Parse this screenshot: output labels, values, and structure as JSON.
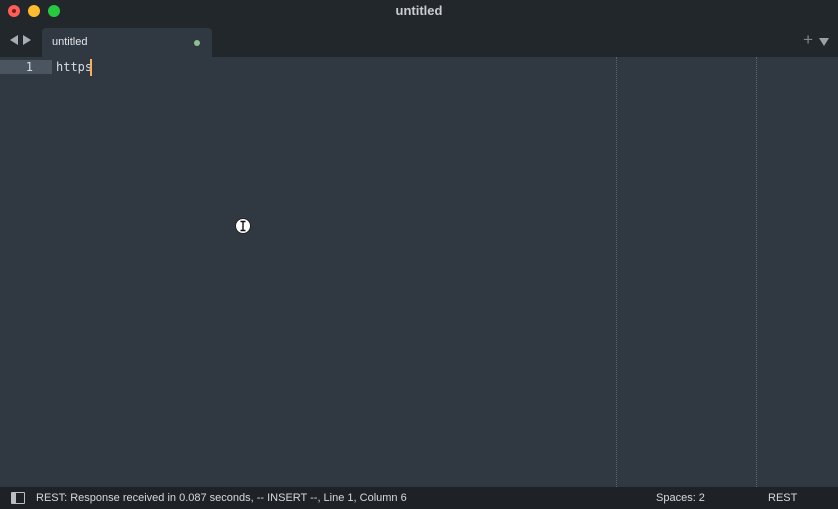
{
  "window": {
    "title": "untitled"
  },
  "tabs": [
    {
      "label": "untitled",
      "modified": true
    }
  ],
  "editor": {
    "lines": [
      {
        "number": "1",
        "text": "https"
      }
    ]
  },
  "statusbar": {
    "message": "REST: Response received in 0.087 seconds, -- INSERT --, Line 1, Column 6",
    "indentation": "Spaces: 2",
    "syntax": "REST"
  },
  "icons": {
    "new_tab": "+",
    "nav_back": "chevron-left-icon",
    "nav_forward": "chevron-right-icon",
    "tab_menu": "chevron-down-icon",
    "sidebar_toggle": "sidebar-toggle-icon"
  },
  "colors": {
    "editor_bg": "#303841",
    "caret": "#f9ae58",
    "modified_dot": "#8bc18f"
  }
}
